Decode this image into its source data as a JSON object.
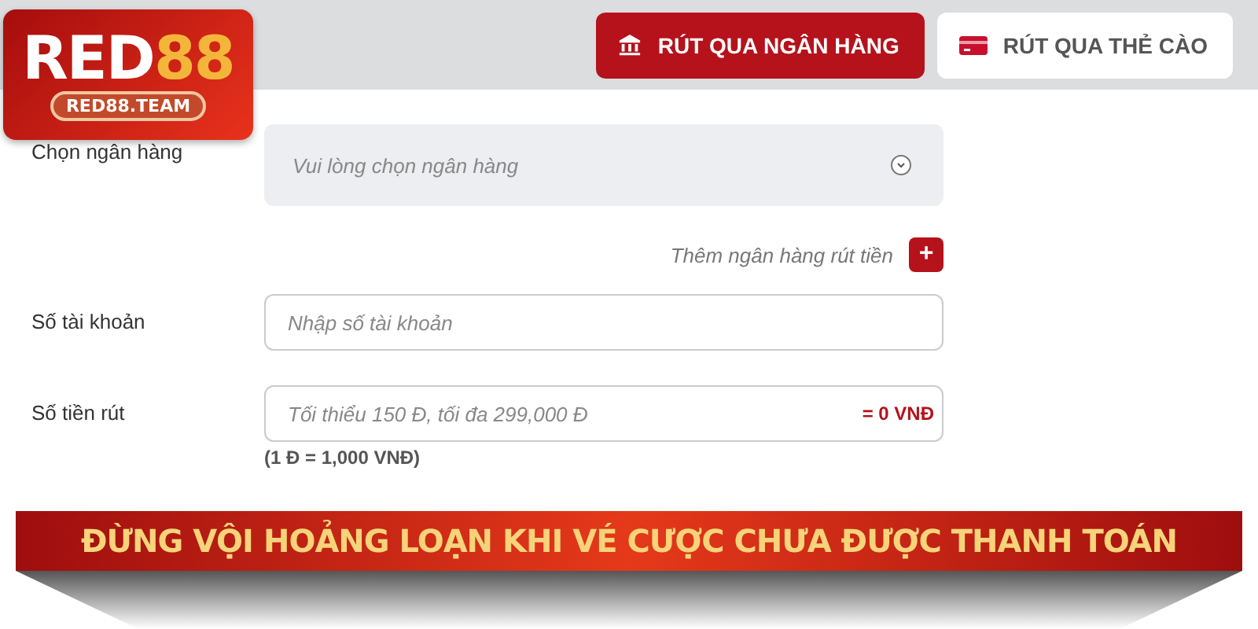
{
  "logo": {
    "text": "RED",
    "accent": "88",
    "domain": "RED88.TEAM"
  },
  "tabs": [
    {
      "label": "RÚT QUA NGÂN HÀNG",
      "kind": "bank",
      "selected": true
    },
    {
      "label": "RÚT QUA THẺ CÀO",
      "kind": "card",
      "selected": false
    }
  ],
  "form": {
    "bank": {
      "label": "Chọn ngân hàng",
      "placeholder": "Vui lòng chọn ngân hàng"
    },
    "add_bank": {
      "label": "Thêm ngân hàng rút tiền",
      "button": "+"
    },
    "account": {
      "label": "Số tài khoản",
      "placeholder": "Nhập số tài khoản"
    },
    "amount": {
      "label": "Số tiền rút",
      "placeholder": "Tối thiểu 150 Đ, tối đa 299,000 Đ",
      "converted": "= 0 VNĐ",
      "rate": "(1 Đ = 1,000 VNĐ)"
    }
  },
  "banner": {
    "title": "ĐỪNG VỘI HOẢNG LOẠN KHI VÉ CƯỢC CHƯA ĐƯỢC THANH TOÁN"
  }
}
